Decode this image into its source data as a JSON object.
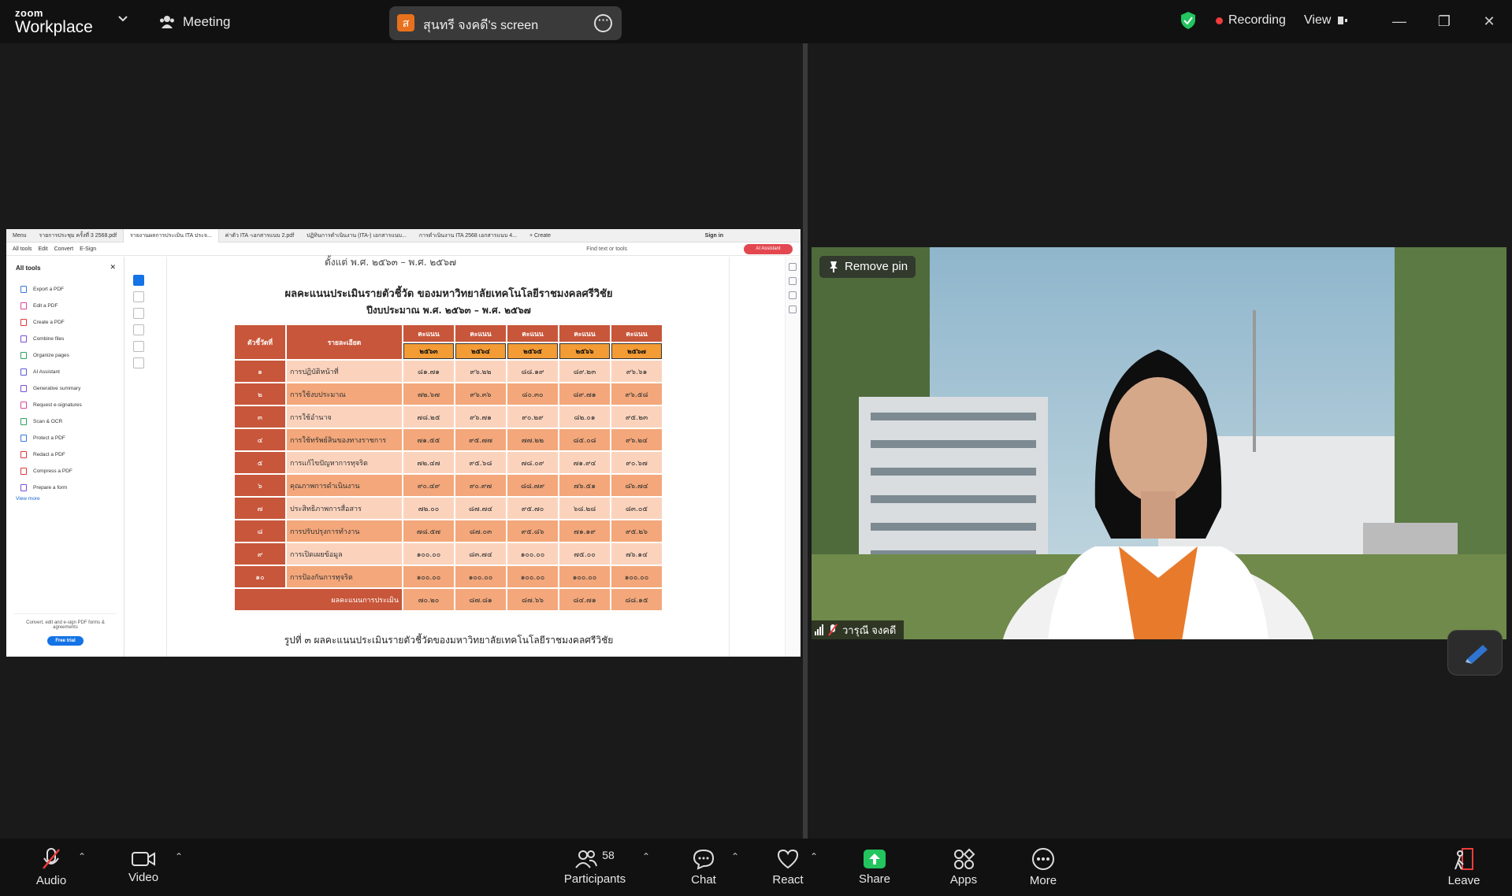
{
  "app": {
    "brand_small": "zoom",
    "brand_large": "Workplace",
    "meeting_label": "Meeting"
  },
  "share": {
    "avatar_letter": "ส",
    "label": "สุนทรี จงคดี's screen"
  },
  "recording": {
    "label": "Recording"
  },
  "view": {
    "label": "View"
  },
  "pdf": {
    "tabs": [
      "Menu",
      "รายการประชุม ครั้งที่ 3 2568.pdf",
      "รายงานผลการประเมิน ITA ประจ...",
      "ค่าตัว ITA -เอกสารแนบ 2.pdf",
      "ปฏิทินการดำเนินงาน (ITA-) เอกสารแนบ...",
      "การดำเนินงาน ITA 2568 เอกสารแนบ 4...",
      "+ Create"
    ],
    "sign_in": "Sign in",
    "menu": [
      "All tools",
      "Edit",
      "Convert",
      "E-Sign"
    ],
    "find": "Find text or tools",
    "ai_button": "AI Assistant",
    "panel_title": "All tools",
    "tools": [
      "Export a PDF",
      "Edit a PDF",
      "Create a PDF",
      "Combine files",
      "Organize pages",
      "AI Assistant",
      "Generative summary",
      "Request e-signatures",
      "Scan & OCR",
      "Protect a PDF",
      "Redact a PDF",
      "Compress a PDF",
      "Prepare a form"
    ],
    "view_more": "View more",
    "promo_text": "Convert, edit and e-sign PDF forms & agreements",
    "promo_button": "Free trial",
    "doc": {
      "cut_line": "ตั้งแต่ พ.ศ. ๒๕๖๓ – พ.ศ. ๒๕๖๗",
      "title": "ผลคะแนนประเมินรายตัวชี้วัด ของมหาวิทยาลัยเทคโนโลยีราชมงคลศรีวิชัย",
      "subtitle": "ปีงบประมาณ พ.ศ. ๒๕๖๓ – พ.ศ. ๒๕๖๗",
      "col_index": "ตัวชี้วัดที่",
      "col_detail": "รายละเอียด",
      "col_score": "คะแนน",
      "years": [
        "๒๕๖๓",
        "๒๕๖๔",
        "๒๕๖๕",
        "๒๕๖๖",
        "๒๕๖๗"
      ],
      "rows": [
        {
          "idx": "๑",
          "detail": "การปฏิบัติหน้าที่",
          "vals": [
            "๘๑.๗๑",
            "๙๖.๒๒",
            "๘๘.๑๙",
            "๘๙.๒๓",
            "๙๖.๖๑"
          ]
        },
        {
          "idx": "๒",
          "detail": "การใช้งบประมาณ",
          "vals": [
            "๗๒.๖๗",
            "๙๖.๓๖",
            "๘๐.๓๐",
            "๘๙.๗๑",
            "๙๖.๕๘"
          ]
        },
        {
          "idx": "๓",
          "detail": "การใช้อำนาจ",
          "vals": [
            "๗๘.๒๕",
            "๙๖.๗๑",
            "๙๐.๒๙",
            "๘๒.๐๑",
            "๙๕.๒๓"
          ]
        },
        {
          "idx": "๔",
          "detail": "การใช้ทรัพย์สินของทางราชการ",
          "vals": [
            "๗๑.๕๕",
            "๙๕.๗๗",
            "๗๗.๒๒",
            "๘๕.๐๘",
            "๙๖.๒๔"
          ]
        },
        {
          "idx": "๕",
          "detail": "การแก้ไขปัญหาการทุจริต",
          "vals": [
            "๗๒.๔๗",
            "๙๕.๖๘",
            "๗๘.๐๙",
            "๗๑.๙๔",
            "๙๐.๖๗"
          ]
        },
        {
          "idx": "๖",
          "detail": "คุณภาพการดำเนินงาน",
          "vals": [
            "๙๐.๔๙",
            "๙๐.๙๗",
            "๘๘.๗๙",
            "๗๖.๕๑",
            "๘๖.๗๔"
          ]
        },
        {
          "idx": "๗",
          "detail": "ประสิทธิภาพการสื่อสาร",
          "vals": [
            "๗๒.๐๐",
            "๘๗.๗๔",
            "๙๕.๗๐",
            "๖๘.๒๘",
            "๘๓.๐๕"
          ]
        },
        {
          "idx": "๘",
          "detail": "การปรับปรุงการทำงาน",
          "vals": [
            "๗๘.๕๗",
            "๘๗.๐๓",
            "๙๕.๘๖",
            "๗๑.๑๙",
            "๙๕.๒๖"
          ]
        },
        {
          "idx": "๙",
          "detail": "การเปิดเผยข้อมูล",
          "vals": [
            "๑๐๐.๐๐",
            "๘๓.๗๔",
            "๑๐๐.๐๐",
            "๗๕.๐๐",
            "๗๖.๑๔"
          ]
        },
        {
          "idx": "๑๐",
          "detail": "การป้องกันการทุจริต",
          "vals": [
            "๑๐๐.๐๐",
            "๑๐๐.๐๐",
            "๑๐๐.๐๐",
            "๑๐๐.๐๐",
            "๑๐๐.๐๐"
          ]
        }
      ],
      "total_label": "ผลคะแนนการประเมิน",
      "totals": [
        "๗๐.๒๐",
        "๘๗.๘๑",
        "๘๗.๖๖",
        "๘๔.๗๑",
        "๘๘.๑๕"
      ],
      "caption": "รูปที่ ๓ ผลคะแนนประเมินรายตัวชี้วัดของมหาวิทยาลัยเทคโนโลยีราชมงคลศรีวิชัย"
    }
  },
  "video": {
    "remove_pin": "Remove pin",
    "name": "วารุณี จงคดี"
  },
  "toolbar": {
    "audio": "Audio",
    "video": "Video",
    "participants": "Participants",
    "participant_count": "58",
    "chat": "Chat",
    "react": "React",
    "share": "Share",
    "apps": "Apps",
    "more": "More",
    "leave": "Leave"
  },
  "colors": {
    "share_green": "#22c55e",
    "recording_red": "#f03c3c",
    "table_header": "#c8563a",
    "year_orange": "#f39b35"
  }
}
